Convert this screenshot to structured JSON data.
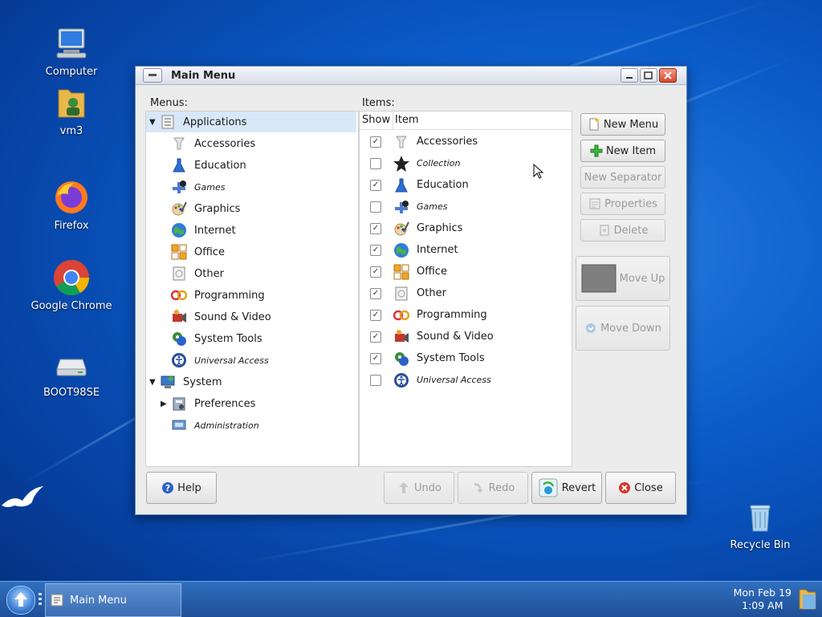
{
  "desktop": {
    "icons": [
      {
        "label": "Computer"
      },
      {
        "label": "vm3"
      },
      {
        "label": "Firefox"
      },
      {
        "label": "Google Chrome"
      },
      {
        "label": "BOOT98SE"
      },
      {
        "label": "Recycle Bin"
      }
    ]
  },
  "window": {
    "title": "Main Menu",
    "menus_label": "Menus:",
    "items_label": "Items:",
    "menus": [
      {
        "label": "Applications",
        "expanded": true,
        "selected": true,
        "italic": false
      },
      {
        "label": "Accessories",
        "italic": false
      },
      {
        "label": "Education",
        "italic": false
      },
      {
        "label": "Games",
        "italic": true
      },
      {
        "label": "Graphics",
        "italic": false
      },
      {
        "label": "Internet",
        "italic": false
      },
      {
        "label": "Office",
        "italic": false
      },
      {
        "label": "Other",
        "italic": false
      },
      {
        "label": "Programming",
        "italic": false
      },
      {
        "label": "Sound & Video",
        "italic": false
      },
      {
        "label": "System Tools",
        "italic": false
      },
      {
        "label": "Universal Access",
        "italic": true
      },
      {
        "label": "System",
        "expanded": true,
        "italic": false
      },
      {
        "label": "Preferences",
        "expanded": false,
        "italic": false
      },
      {
        "label": "Administration",
        "italic": true
      }
    ],
    "items_columns": {
      "show": "Show",
      "item": "Item"
    },
    "items": [
      {
        "label": "Accessories",
        "checked": true,
        "italic": false
      },
      {
        "label": "Collection",
        "checked": false,
        "italic": true
      },
      {
        "label": "Education",
        "checked": true,
        "italic": false
      },
      {
        "label": "Games",
        "checked": false,
        "italic": true
      },
      {
        "label": "Graphics",
        "checked": true,
        "italic": false
      },
      {
        "label": "Internet",
        "checked": true,
        "italic": false
      },
      {
        "label": "Office",
        "checked": true,
        "italic": false
      },
      {
        "label": "Other",
        "checked": true,
        "italic": false
      },
      {
        "label": "Programming",
        "checked": true,
        "italic": false
      },
      {
        "label": "Sound & Video",
        "checked": true,
        "italic": false
      },
      {
        "label": "System Tools",
        "checked": true,
        "italic": false
      },
      {
        "label": "Universal Access",
        "checked": false,
        "italic": true
      }
    ],
    "buttons": {
      "new_menu": "New Menu",
      "new_item": "New Item",
      "new_separator": "New Separator",
      "properties": "Properties",
      "delete": "Delete",
      "move_up": "Move Up",
      "move_down": "Move Down",
      "help": "Help",
      "undo": "Undo",
      "redo": "Redo",
      "revert": "Revert",
      "close": "Close"
    }
  },
  "taskbar": {
    "task_label": "Main Menu",
    "clock_date": "Mon Feb 19",
    "clock_time": "1:09 AM"
  },
  "colors": {
    "desktop_bg": "#0a5bc9",
    "selection": "#d8e8f8",
    "taskbar": "#2f6fbf"
  }
}
